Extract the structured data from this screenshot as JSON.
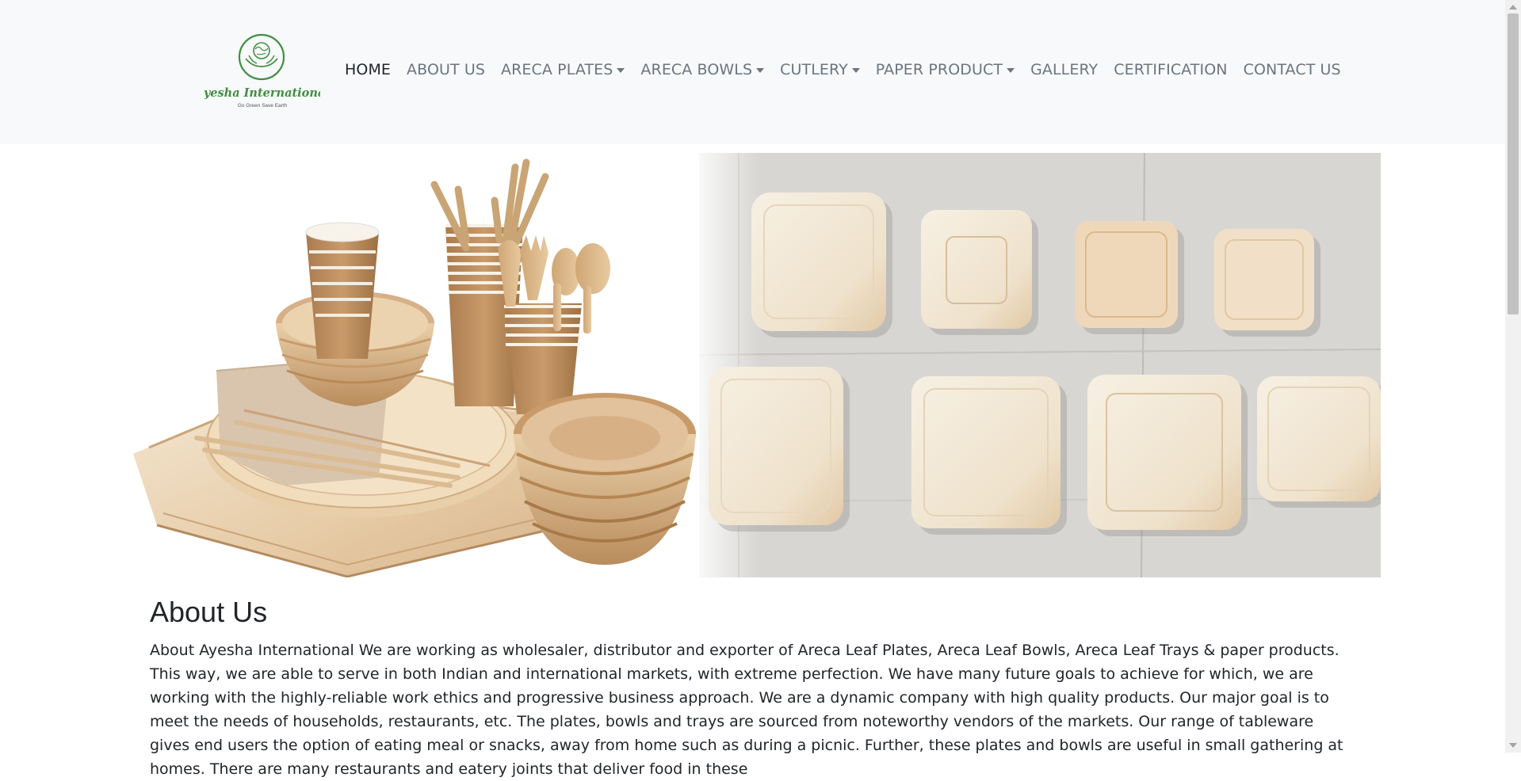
{
  "brand": {
    "name": "Ayesha International",
    "tagline": "Go Green Save Earth",
    "color": "#3f8f3f"
  },
  "nav": {
    "items": [
      {
        "label": "HOME",
        "dropdown": false,
        "active": true
      },
      {
        "label": "ABOUT US",
        "dropdown": false,
        "active": false
      },
      {
        "label": "ARECA PLATES",
        "dropdown": true,
        "active": false
      },
      {
        "label": "ARECA BOWLS",
        "dropdown": true,
        "active": false
      },
      {
        "label": "CUTLERY",
        "dropdown": true,
        "active": false
      },
      {
        "label": "PAPER PRODUCT",
        "dropdown": true,
        "active": false
      },
      {
        "label": "GALLERY",
        "dropdown": false,
        "active": false
      },
      {
        "label": "CERTIFICATION",
        "dropdown": false,
        "active": false
      },
      {
        "label": "CONTACT US",
        "dropdown": false,
        "active": false
      }
    ]
  },
  "about": {
    "title": "About Us",
    "text": "About Ayesha International We are working as wholesaler, distributor and exporter of Areca Leaf Plates, Areca Leaf Bowls, Areca Leaf Trays & paper products. This way, we are able to serve in both Indian and international markets, with extreme perfection. We have many future goals to achieve for which, we are working with the highly-reliable work ethics and progressive business approach. We are a dynamic company with high quality products. Our major goal is to meet the needs of households, restaurants, etc. The plates, bowls and trays are sourced from noteworthy vendors of the markets. Our range of tableware gives end users the option of eating meal or snacks, away from home such as during a picnic. Further, these plates and bowls are useful in small gathering at homes. There are many restaurants and eatery joints that deliver food in these"
  },
  "colors": {
    "navbar_bg": "#f8f9fa",
    "nav_text": "#6c757d",
    "nav_active": "#212529",
    "body_text": "#212529"
  }
}
